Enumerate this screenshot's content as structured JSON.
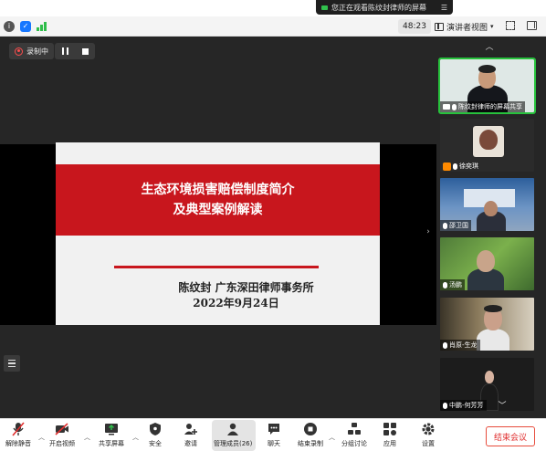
{
  "banner": {
    "text": "您正在观看陈纹封律师的屏幕",
    "menu_icon": "menu-icon"
  },
  "topbar": {
    "timer": "48:23",
    "view_mode": "演讲者视图"
  },
  "recording": {
    "label": "录制中"
  },
  "slide": {
    "title_line1": "生态环境损害赔偿制度简介",
    "title_line2": "及典型案例解读",
    "author_line": "陈纹封  广东深田律师事务所",
    "date_line": "2022年9月24日"
  },
  "participants": [
    {
      "name": "陈纹封律师的屏幕共享",
      "active": true
    },
    {
      "name": "徐奕琪",
      "active": false
    },
    {
      "name": "邵卫国",
      "active": false
    },
    {
      "name": "汤鹏",
      "active": false
    },
    {
      "name": "肖原-生龙",
      "active": false
    },
    {
      "name": "中鹏-何芳芳",
      "active": false
    }
  ],
  "toolbar": {
    "unmute": "解除静音",
    "video": "开启视频",
    "share": "共享屏幕",
    "security": "安全",
    "invite": "邀请",
    "manage": "管理成员(26)",
    "chat": "聊天",
    "end_record": "结束录制",
    "breakout": "分组讨论",
    "apps": "应用",
    "settings": "设置",
    "end_meeting": "结束会议"
  },
  "colors": {
    "accent_green": "#27c23c",
    "slide_red": "#c8161d",
    "end_red": "#e02e2e"
  }
}
